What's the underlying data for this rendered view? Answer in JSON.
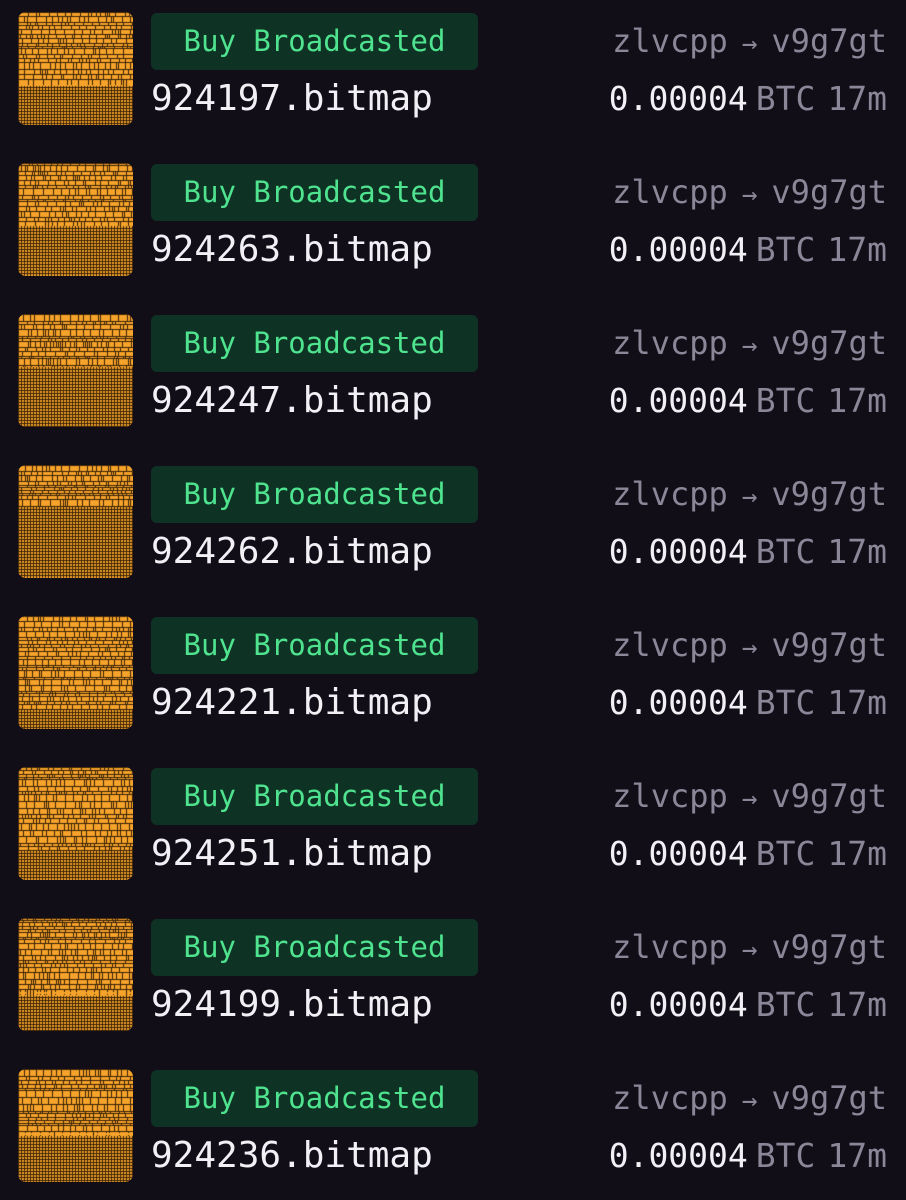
{
  "colors": {
    "background": "#110e18",
    "badge_bg": "#0e3324",
    "badge_text": "#4fe38f",
    "primary_text": "#f1f0f5",
    "muted_text": "#8b8798",
    "bitmap_orange": "#f5a32a"
  },
  "activity": [
    {
      "status": "Buy Broadcasted",
      "name": "924197.bitmap",
      "from": "zlvcpp",
      "arrow": "→",
      "to": "v9g7gt",
      "price": "0.00004",
      "unit": "BTC",
      "age": "17m",
      "thumb_icon": "bitmap-mosaic-icon"
    },
    {
      "status": "Buy Broadcasted",
      "name": "924263.bitmap",
      "from": "zlvcpp",
      "arrow": "→",
      "to": "v9g7gt",
      "price": "0.00004",
      "unit": "BTC",
      "age": "17m",
      "thumb_icon": "bitmap-mosaic-icon"
    },
    {
      "status": "Buy Broadcasted",
      "name": "924247.bitmap",
      "from": "zlvcpp",
      "arrow": "→",
      "to": "v9g7gt",
      "price": "0.00004",
      "unit": "BTC",
      "age": "17m",
      "thumb_icon": "bitmap-mosaic-icon"
    },
    {
      "status": "Buy Broadcasted",
      "name": "924262.bitmap",
      "from": "zlvcpp",
      "arrow": "→",
      "to": "v9g7gt",
      "price": "0.00004",
      "unit": "BTC",
      "age": "17m",
      "thumb_icon": "bitmap-mosaic-icon"
    },
    {
      "status": "Buy Broadcasted",
      "name": "924221.bitmap",
      "from": "zlvcpp",
      "arrow": "→",
      "to": "v9g7gt",
      "price": "0.00004",
      "unit": "BTC",
      "age": "17m",
      "thumb_icon": "bitmap-mosaic-icon"
    },
    {
      "status": "Buy Broadcasted",
      "name": "924251.bitmap",
      "from": "zlvcpp",
      "arrow": "→",
      "to": "v9g7gt",
      "price": "0.00004",
      "unit": "BTC",
      "age": "17m",
      "thumb_icon": "bitmap-mosaic-icon"
    },
    {
      "status": "Buy Broadcasted",
      "name": "924199.bitmap",
      "from": "zlvcpp",
      "arrow": "→",
      "to": "v9g7gt",
      "price": "0.00004",
      "unit": "BTC",
      "age": "17m",
      "thumb_icon": "bitmap-mosaic-icon"
    },
    {
      "status": "Buy Broadcasted",
      "name": "924236.bitmap",
      "from": "zlvcpp",
      "arrow": "→",
      "to": "v9g7gt",
      "price": "0.00004",
      "unit": "BTC",
      "age": "17m",
      "thumb_icon": "bitmap-mosaic-icon"
    }
  ]
}
